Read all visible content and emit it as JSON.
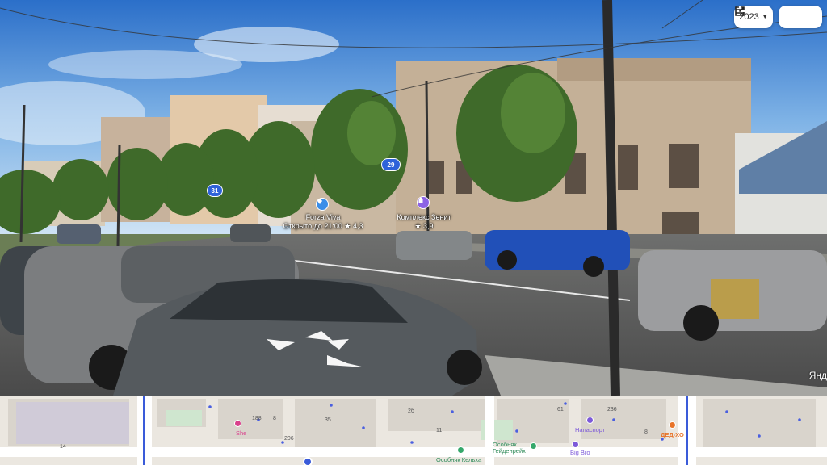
{
  "controls": {
    "year": "2023",
    "year_caret": "▼",
    "share_icon": "external-link-icon",
    "menu_icon": "hamburger-menu-icon"
  },
  "poi": [
    {
      "name": "Forza Viva",
      "status": "Открыто до 21:00",
      "rating": "★ 4,3",
      "color": "#3a8ee8",
      "icon": "gem-icon"
    },
    {
      "name": "Комплекс Зенит",
      "rating": "★ 3,9",
      "color": "#8c63e6",
      "icon": "building-icon"
    }
  ],
  "route_badges": [
    "29",
    "31"
  ],
  "watermark": "Янд",
  "colors": {
    "route_badge": "#2f62d9",
    "poi_blue": "#3a8ee8",
    "poi_purple": "#8c63e6"
  },
  "minimap": {
    "numbers": [
      "14",
      "188",
      "8",
      "206",
      "35",
      "2б",
      "11",
      "61",
      "236",
      "8"
    ],
    "pois": [
      {
        "name": "She",
        "color": "#d9418c"
      },
      {
        "name": "Напаспорт",
        "color": "#7d5ad9"
      },
      {
        "name": "ДЕД-ХО",
        "color": "#e8742a"
      },
      {
        "name": "Особняк Гейденрейх",
        "color": "#35a86b"
      },
      {
        "name": "Big Bro",
        "color": "#7d5ad9"
      },
      {
        "name": "Особняк Кельха",
        "color": "#35a86b"
      }
    ]
  }
}
